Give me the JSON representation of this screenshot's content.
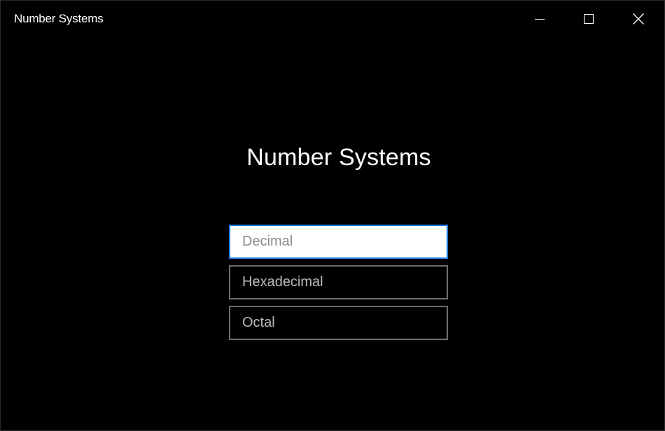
{
  "window": {
    "title": "Number Systems",
    "controls": {
      "minimize_icon": "minimize-icon",
      "maximize_icon": "maximize-icon",
      "close_icon": "close-icon"
    }
  },
  "main": {
    "heading": "Number Systems",
    "fields": [
      {
        "placeholder": "Decimal",
        "value": "",
        "focused": true
      },
      {
        "placeholder": "Hexadecimal",
        "value": "",
        "focused": false
      },
      {
        "placeholder": "Octal",
        "value": "",
        "focused": false
      }
    ]
  },
  "colors": {
    "background": "#000000",
    "text": "#ffffff",
    "accent": "#1f7ae0",
    "field_border": "#6e6e6e"
  }
}
